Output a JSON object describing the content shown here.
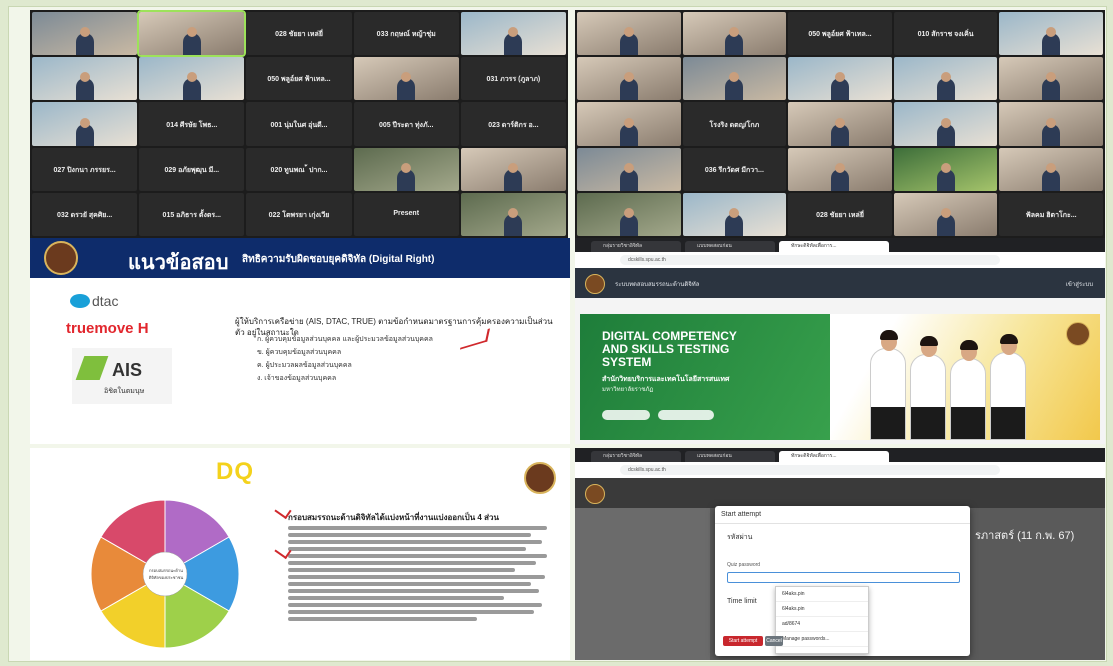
{
  "zoom_left": {
    "tiles": [
      {
        "name": "",
        "cap": "",
        "kind": "video"
      },
      {
        "name": "",
        "cap": "",
        "kind": "video v4",
        "active": true
      },
      {
        "name": "028 ชัยยา เหล่ยี่",
        "cap": ""
      },
      {
        "name": "033 กฤษณ์ หญ้าชุ่ม",
        "cap": ""
      },
      {
        "name": "",
        "cap": "",
        "kind": "video v2"
      },
      {
        "name": "",
        "cap": "",
        "kind": "video v2"
      },
      {
        "name": "",
        "cap": "",
        "kind": "video v2"
      },
      {
        "name": "050 พลูอ์ยศ ฟ้าเทล...",
        "cap": ""
      },
      {
        "name": "",
        "cap": "",
        "kind": "video v4"
      },
      {
        "name": "031 ภวรร (ภูลาภ)",
        "cap": ""
      },
      {
        "name": "",
        "cap": "",
        "kind": "video v2"
      },
      {
        "name": "014 ศีรษัย โพธ...",
        "cap": ""
      },
      {
        "name": "001 นุ่มในศ อุ่นดี...",
        "cap": ""
      },
      {
        "name": "005 ปีระดา ทุ่งภั...",
        "cap": ""
      },
      {
        "name": "023 ดาร์ติกร อ...",
        "cap": ""
      },
      {
        "name": "027 ปิงกนา ภรรยร...",
        "cap": ""
      },
      {
        "name": "029 อภัยพุฒุน มี...",
        "cap": ""
      },
      {
        "name": "020 ทูนพณ ้ ปาก...",
        "cap": ""
      },
      {
        "name": "",
        "cap": "",
        "kind": "video v3"
      },
      {
        "name": "",
        "cap": "",
        "kind": "video v4"
      },
      {
        "name": "032 ดรวยั สุคศิย...",
        "cap": ""
      },
      {
        "name": "015 อภิธาร ตั้งตร...",
        "cap": ""
      },
      {
        "name": "022 โตพรยา เกุ่งเวีย",
        "cap": ""
      },
      {
        "name": "Present",
        "cap": ""
      },
      {
        "name": "",
        "cap": "",
        "kind": "video v3"
      }
    ]
  },
  "zoom_right": {
    "tiles": [
      {
        "name": "",
        "kind": "video v4"
      },
      {
        "name": "",
        "kind": "video v4"
      },
      {
        "name": "050 พลูอ์ยศ ฟ้าเทล...",
        "cap": ""
      },
      {
        "name": "010 สักราช จงเคิ่น",
        "cap": ""
      },
      {
        "name": "",
        "kind": "video v2"
      },
      {
        "name": "",
        "kind": "video v4"
      },
      {
        "name": "",
        "kind": "video"
      },
      {
        "name": "",
        "kind": "video v2"
      },
      {
        "name": "",
        "kind": "video v2"
      },
      {
        "name": "",
        "kind": "video v4"
      },
      {
        "name": "",
        "kind": "video v4"
      },
      {
        "name": "โรงริง ดตญ/โกภ",
        "cap": ""
      },
      {
        "name": "",
        "kind": "video v4"
      },
      {
        "name": "",
        "kind": "video v2"
      },
      {
        "name": "",
        "kind": "video v4"
      },
      {
        "name": "",
        "kind": "video"
      },
      {
        "name": "036 รีกวัดศ มีกวา...",
        "cap": ""
      },
      {
        "name": "",
        "kind": "video v4"
      },
      {
        "name": "",
        "kind": "video v5"
      },
      {
        "name": "",
        "kind": "video v4"
      },
      {
        "name": "",
        "kind": "video v3"
      },
      {
        "name": "",
        "kind": "video v2"
      },
      {
        "name": "028 ชัยยา เหล่ยี่",
        "cap": ""
      },
      {
        "name": "",
        "kind": "video v4"
      },
      {
        "name": "ฟัลคม ฮิตาโกะ...",
        "cap": ""
      }
    ]
  },
  "slide_exam": {
    "title_big": "แนวข้อสอบ",
    "title_sub": "สิทธิความรับผิดชอบยุคดิจิทัล (Digital Right)",
    "brand_dtac": "dtac",
    "brand_true": "truemove H",
    "brand_ais": "AIS",
    "brand_ais_sub": "อิชิตในตมนุษ",
    "question": "ผู้ให้บริการเครือข่าย (AIS, DTAC, TRUE) ตามข้อกำหนดมาตรฐานการคุ้มครองความเป็นส่วนตัว อยู่ในสถานะใด",
    "options": [
      "ก. ผู้ควบคุมข้อมูลส่วนบุคคล และผู้ประมวลข้อมูลส่วนบุคคล",
      "ข. ผู้ควบคุมข้อมูลส่วนบุคคล",
      "ค. ผู้ประมวลผลข้อมูลส่วนบุคคล",
      "ง. เจ้าของข้อมูลส่วนบุคคล"
    ]
  },
  "browser_top": {
    "tabs": [
      "กลุ่มรายวิชาอิจิทัล",
      "แบบทดสอบก่อน",
      "ทักษะดิจิทัลเพื่อการ..."
    ],
    "url": "dcskills.spu.ac.th",
    "site_nav": "ระบบทดสอบสมรรถนะด้านดิจิทัล",
    "site_right": "เข้าสู่ระบบ",
    "hero_title": "DIGITAL COMPETENCY\nAND SKILLS TESTING\nSYSTEM",
    "hero_th1": "สำนักวิทยบริการและเทคโนโลยีสารสนเทศ",
    "hero_th2": "มหาวิทยาลัยราชภัฏ"
  },
  "slide_dq": {
    "title": "DQ",
    "heading": "กรอบสมรรถนะด้านดิจิทัลได้แบ่งหน้าที่งานแบ่งออกเป็น 4 ส่วน",
    "wheel_center": "กรอบสมรรถนะด้านดิจิทัลของประชาชน",
    "colors": [
      "#b06bc6",
      "#3d9be0",
      "#9ed04a",
      "#f2d02a",
      "#e88a3a",
      "#d8496a"
    ]
  },
  "browser_bottom": {
    "modal_title": "Start attempt",
    "modal_sub": "รหัสผ่าน",
    "field_label": "Quiz password",
    "time_limit": "Time limit",
    "suggestions": [
      "6l4aks.pin",
      "6l4aks.pin",
      "ad/8674",
      "Manage passwords..."
    ],
    "start_button": "Start attempt",
    "cancel_button": "Cancel",
    "right_title": "รภาสตร์ (11 ก.พ. 67)"
  }
}
